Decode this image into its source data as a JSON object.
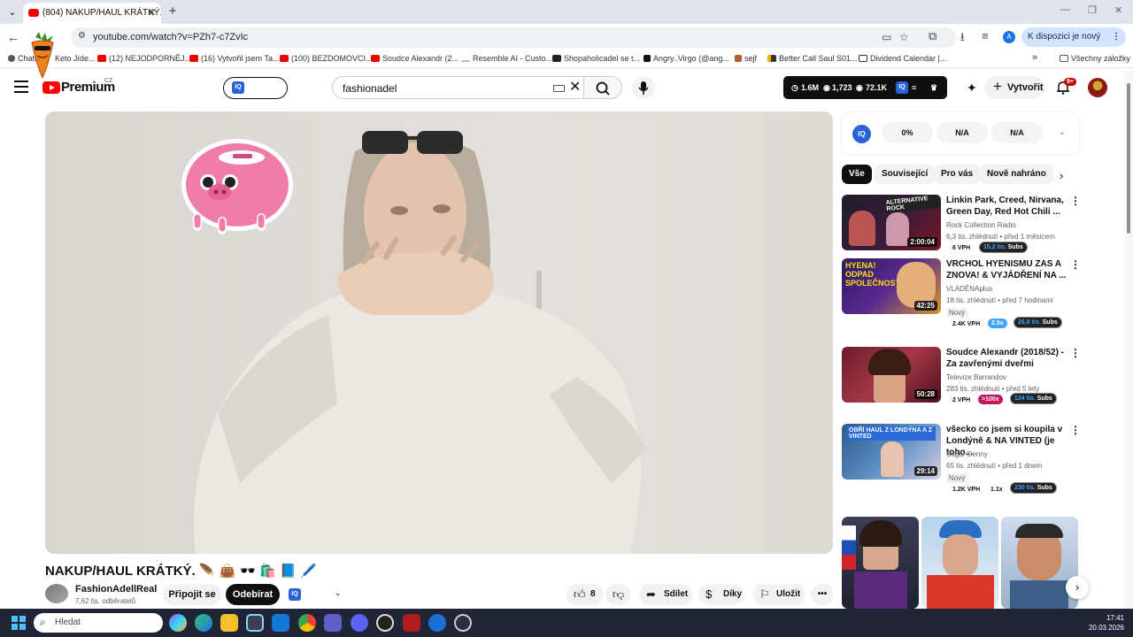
{
  "browser": {
    "tab_title": "(804) NAKUP/HAUL KRÁTKÝ. 🪶",
    "url": "youtube.com/watch?v=PZh7-c7ZvIc",
    "update_label": "K dispozici je nový Chrome",
    "profile_initial": "A",
    "bookmarks": [
      "Chatt...",
      "Keto Jíde...",
      "(12) NEJODPORNĚJ...",
      "(16) Vytvořil jsem Ta...",
      "(100) BEZDOMOVCI...",
      "Soudce Alexandr (2...",
      "Resemble AI - Custo...",
      "Shopaholicadel se t...",
      "Angry..Virgo (@ang...",
      "sejf",
      "Better Call Saul S01...",
      "Dividend Calendar |..."
    ],
    "all_bookmarks": "Všechny záložky"
  },
  "header": {
    "logo_text": "Premium",
    "country": "CZ",
    "search_query": "fashionadel",
    "stats": [
      "1.6M",
      "1,723",
      "72.1K"
    ],
    "create_label": "Vytvořit",
    "notifications": "9+"
  },
  "video": {
    "title": "NAKUP/HAUL KRÁTKÝ. 🪶 👜 🕶️ 🛍️ 📘 🖊️",
    "channel": "FashionAdellReal",
    "subscribers": "7,62 tis. odběratelů",
    "join_label": "Připojit se",
    "subscribe_label": "Odebírat",
    "likes": "8",
    "share_label": "Sdílet",
    "thanks_label": "Díky",
    "save_label": "Uložit"
  },
  "iq_panel": {
    "metrics": [
      "0%",
      "N/A",
      "N/A"
    ]
  },
  "chips": [
    "Vše",
    "Související",
    "Pro vás",
    "Nově nahráno"
  ],
  "recommendations": [
    {
      "title": "Linkin Park, Creed, Nirvana, Green Day, Red Hot Chili ...",
      "channel": "Rock Collection Radio",
      "meta": "6,3 tis. zhlédnutí • před 1 měsícem",
      "duration": "2:00:04",
      "thumb_text": "ALTERNATIVE ROCK",
      "vph": "6 VPH",
      "mult": "",
      "subs": "15,2 tis.",
      "subs_label": "Subs",
      "new": ""
    },
    {
      "title": "VRCHOL HYENISMU ZAS A ZNOVA! & VYJÁDŘENÍ NA ...",
      "channel": "VLADĚNAplus",
      "meta": "18 tis. zhlédnutí • před 7 hodinami",
      "duration": "42:25",
      "thumb_text": "HYENA! ODPAD SPOLEČNOSTI!",
      "vph": "2.4K VPH",
      "mult": "2.5x",
      "subs": "26,8 tis.",
      "subs_label": "Subs",
      "new": "Nový"
    },
    {
      "title": "Soudce Alexandr (2018/52) - Za zavřenými dveřmi",
      "channel": "Televize Barrandov",
      "meta": "283 tis. zhlédnutí • před 5 lety",
      "duration": "50:28",
      "thumb_text": "",
      "vph": "2 VPH",
      "mult": ">100x",
      "subs": "124 tis.",
      "subs_label": "Subs",
      "new": ""
    },
    {
      "title": "všecko co jsem si koupila v Londýně & NA VINTED (je toho...",
      "channel": "Sugar Denny",
      "meta": "65 tis. zhlédnutí • před 1 dnem",
      "duration": "29:14",
      "thumb_text": "OBŘÍ HAUL Z LONDÝNA A Z VINTED",
      "vph": "1.2K VPH",
      "mult": "1.1x",
      "subs": "230 tis.",
      "subs_label": "Subs",
      "new": "Nový"
    }
  ],
  "taskbar": {
    "search_placeholder": "Hledat",
    "time": "17:41",
    "date": "20.03.2026"
  },
  "colors": {
    "yt_red": "#ff0000",
    "iq_blue": "#2a63d8",
    "vph_blue": "#3ea6ff",
    "mult_red": "#c2185b",
    "taskbar": "#1f2536"
  }
}
